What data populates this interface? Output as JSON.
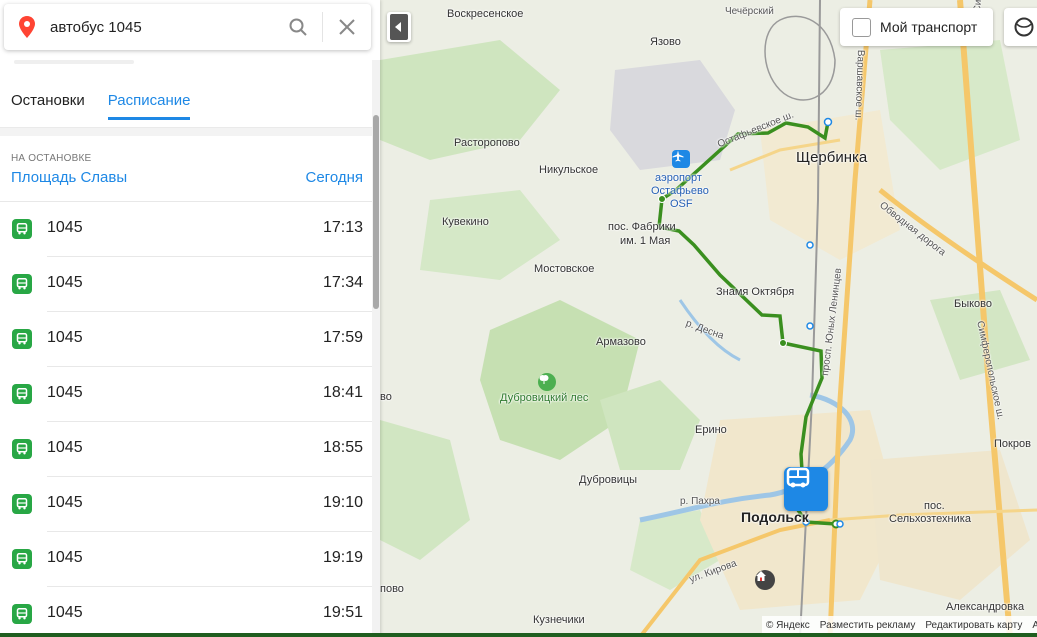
{
  "search": {
    "query": "автобус 1045",
    "pin_icon": "map-pin-icon",
    "search_icon": "search-icon",
    "close_icon": "close-icon"
  },
  "tabs": [
    {
      "label": "Остановки",
      "active": false
    },
    {
      "label": "Расписание",
      "active": true
    }
  ],
  "stop": {
    "caption": "НА ОСТАНОВКЕ",
    "name": "Площадь Славы",
    "date": "Сегодня"
  },
  "schedule": [
    {
      "route": "1045",
      "time": "17:13"
    },
    {
      "route": "1045",
      "time": "17:34"
    },
    {
      "route": "1045",
      "time": "17:59"
    },
    {
      "route": "1045",
      "time": "18:41"
    },
    {
      "route": "1045",
      "time": "18:55"
    },
    {
      "route": "1045",
      "time": "19:10"
    },
    {
      "route": "1045",
      "time": "19:19"
    },
    {
      "route": "1045",
      "time": "19:51"
    }
  ],
  "map": {
    "my_transport_label": "Мой транспорт",
    "labels": {
      "voskresenskoe": "Воскресенское",
      "yazovo": "Язово",
      "chech": "Чечёрский",
      "rastoropovo": "Расторопово",
      "nikulskoe": "Никульское",
      "airport1": "аэропорт",
      "airport2": "Остафьево",
      "airport3": "OSF",
      "shcherbinka": "Щербинка",
      "ostafevskoe": "Остафьевское ш.",
      "varshavskoe": "Варшавское ш.",
      "kuvekino": "Кувекино",
      "fabriki1": "пос. Фабрики",
      "fabriki2": "им. 1 Мая",
      "mostovskoe": "Мостовское",
      "znamya": "Знамя Октября",
      "obvodnaya": "Обводная дорога",
      "bykovo": "Быково",
      "yunyh": "просп. Юных Ленинцев",
      "armazovo": "Армазово",
      "desna": "р. Десна",
      "dubrovitsky_les": "Дубровицкий лес",
      "simf": "Симферопольское ш.",
      "simf_top": "Симферопо",
      "vo": "во",
      "erino": "Ерино",
      "pokrov": "Покров",
      "dubrovitsy": "Дубровицы",
      "pahra": "р. Пахра",
      "podolsk": "Подольск",
      "selhoz1": "пос.",
      "selhoz2": "Сельхозтехника",
      "kirova": "ул. Кирова",
      "povo": "пово",
      "kuznechiki": "Кузнечики",
      "aleksandrovka": "Александровка"
    }
  },
  "copyright": {
    "yandex": "© Яндекс",
    "ads": "Разместить рекламу",
    "edit": "Редактировать карту",
    "more": "А"
  },
  "colors": {
    "accent": "#1e88e5",
    "route": "#3a8f1f",
    "bus_badge": "#28a745"
  }
}
